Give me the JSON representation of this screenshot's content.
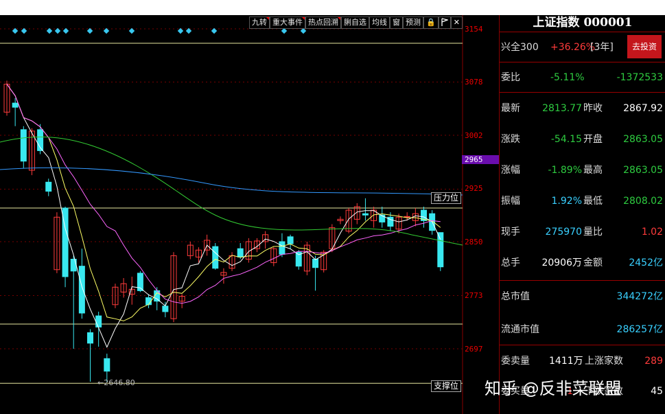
{
  "toolbar": {
    "buttons": [
      "九转",
      "重大事件",
      "热点回溯",
      "脷自选",
      "均线",
      "窗",
      "预测"
    ],
    "lock_icon": "lock-icon",
    "flag_icon": "flag-icon",
    "close_icon": "close-icon"
  },
  "price_axis": {
    "ticks": [
      "3154",
      "3078",
      "3002",
      "2925",
      "2850",
      "2773",
      "2697"
    ],
    "highlight": "2965"
  },
  "chart_labels": {
    "pressure": "压力位",
    "support": "支撑位",
    "low_marker": "2646.80"
  },
  "colors": {
    "up": "#ff3b3b",
    "down": "#39e8f0",
    "ma5": "#ffffff",
    "ma10": "#ffff66",
    "ma20": "#ff66ff",
    "ma60": "#33cc33",
    "ma120": "#3399ff"
  },
  "chart_data": {
    "type": "candlestick",
    "ylim": [
      2640,
      3160
    ],
    "price_ticks": [
      3154,
      3078,
      3002,
      2925,
      2850,
      2773,
      2697
    ],
    "current_price_marker": 2965,
    "pressure_level": 2898,
    "support_level": 2646.8,
    "low_label": 2646.8,
    "candles": [
      {
        "o": 3035,
        "c": 3075,
        "h": 3080,
        "l": 3030
      },
      {
        "o": 3048,
        "c": 3042,
        "h": 3055,
        "l": 3015
      },
      {
        "o": 3010,
        "c": 2965,
        "h": 3015,
        "l": 2955
      },
      {
        "o": 2952,
        "c": 3008,
        "h": 3012,
        "l": 2945
      },
      {
        "o": 3010,
        "c": 2980,
        "h": 3018,
        "l": 2975
      },
      {
        "o": 2935,
        "c": 2922,
        "h": 2940,
        "l": 2915
      },
      {
        "o": 2810,
        "c": 2885,
        "h": 2892,
        "l": 2805
      },
      {
        "o": 2898,
        "c": 2800,
        "h": 2900,
        "l": 2785
      },
      {
        "o": 2825,
        "c": 2808,
        "h": 2830,
        "l": 2697
      },
      {
        "o": 2815,
        "c": 2748,
        "h": 2840,
        "l": 2740
      },
      {
        "o": 2720,
        "c": 2705,
        "h": 2725,
        "l": 2650
      },
      {
        "o": 2744,
        "c": 2728,
        "h": 2750,
        "l": 2700
      },
      {
        "o": 2683,
        "c": 2665,
        "h": 2690,
        "l": 2650
      },
      {
        "o": 2760,
        "c": 2785,
        "h": 2790,
        "l": 2755
      },
      {
        "o": 2778,
        "c": 2790,
        "h": 2798,
        "l": 2770
      },
      {
        "o": 2775,
        "c": 2782,
        "h": 2800,
        "l": 2760
      },
      {
        "o": 2805,
        "c": 2780,
        "h": 2808,
        "l": 2778
      },
      {
        "o": 2770,
        "c": 2760,
        "h": 2775,
        "l": 2755
      },
      {
        "o": 2780,
        "c": 2765,
        "h": 2785,
        "l": 2752
      },
      {
        "o": 2758,
        "c": 2750,
        "h": 2764,
        "l": 2742
      },
      {
        "o": 2740,
        "c": 2830,
        "h": 2835,
        "l": 2735
      },
      {
        "o": 2765,
        "c": 2772,
        "h": 2775,
        "l": 2755
      },
      {
        "o": 2830,
        "c": 2845,
        "h": 2850,
        "l": 2825
      },
      {
        "o": 2828,
        "c": 2838,
        "h": 2842,
        "l": 2820
      },
      {
        "o": 2838,
        "c": 2852,
        "h": 2860,
        "l": 2830
      },
      {
        "o": 2843,
        "c": 2812,
        "h": 2848,
        "l": 2810
      },
      {
        "o": 2802,
        "c": 2806,
        "h": 2812,
        "l": 2790
      },
      {
        "o": 2812,
        "c": 2830,
        "h": 2835,
        "l": 2808
      },
      {
        "o": 2840,
        "c": 2828,
        "h": 2848,
        "l": 2825
      },
      {
        "o": 2825,
        "c": 2850,
        "h": 2855,
        "l": 2820
      },
      {
        "o": 2840,
        "c": 2851,
        "h": 2855,
        "l": 2835
      },
      {
        "o": 2850,
        "c": 2860,
        "h": 2865,
        "l": 2840
      },
      {
        "o": 2820,
        "c": 2840,
        "h": 2842,
        "l": 2815
      },
      {
        "o": 2850,
        "c": 2832,
        "h": 2862,
        "l": 2828
      },
      {
        "o": 2857,
        "c": 2847,
        "h": 2860,
        "l": 2840
      },
      {
        "o": 2835,
        "c": 2815,
        "h": 2838,
        "l": 2810
      },
      {
        "o": 2808,
        "c": 2845,
        "h": 2850,
        "l": 2802
      },
      {
        "o": 2825,
        "c": 2813,
        "h": 2830,
        "l": 2780
      },
      {
        "o": 2810,
        "c": 2835,
        "h": 2838,
        "l": 2806
      },
      {
        "o": 2840,
        "c": 2870,
        "h": 2875,
        "l": 2835
      },
      {
        "o": 2880,
        "c": 2882,
        "h": 2886,
        "l": 2875
      },
      {
        "o": 2865,
        "c": 2895,
        "h": 2898,
        "l": 2862
      },
      {
        "o": 2882,
        "c": 2900,
        "h": 2905,
        "l": 2875
      },
      {
        "o": 2890,
        "c": 2888,
        "h": 2912,
        "l": 2880
      },
      {
        "o": 2880,
        "c": 2895,
        "h": 2900,
        "l": 2870
      },
      {
        "o": 2888,
        "c": 2878,
        "h": 2900,
        "l": 2870
      },
      {
        "o": 2885,
        "c": 2872,
        "h": 2892,
        "l": 2865
      },
      {
        "o": 2868,
        "c": 2885,
        "h": 2890,
        "l": 2862
      },
      {
        "o": 2885,
        "c": 2886,
        "h": 2892,
        "l": 2880
      },
      {
        "o": 2880,
        "c": 2890,
        "h": 2898,
        "l": 2872
      },
      {
        "o": 2895,
        "c": 2880,
        "h": 2900,
        "l": 2870
      },
      {
        "o": 2890,
        "c": 2866,
        "h": 2895,
        "l": 2860
      },
      {
        "o": 2863,
        "c": 2814,
        "h": 2863,
        "l": 2808
      }
    ]
  },
  "panel": {
    "title": "上证指数 000001",
    "row1": {
      "label": "兴全300",
      "pct": "+36.26%",
      "period": "[3年]",
      "button": "去投资"
    },
    "row2": {
      "label": "委比",
      "v1": "-5.11%",
      "v2": "-1372533"
    },
    "rows": [
      {
        "l1": "最新",
        "v1": "2813.77",
        "l2": "昨收",
        "v2": "2867.92",
        "c1": "g",
        "c2": "w"
      },
      {
        "l1": "涨跌",
        "v1": "-54.15",
        "l2": "开盘",
        "v2": "2863.05",
        "c1": "g",
        "c2": "g"
      },
      {
        "l1": "涨幅",
        "v1": "-1.89%",
        "l2": "最高",
        "v2": "2863.05",
        "c1": "g",
        "c2": "g"
      },
      {
        "l1": "振幅",
        "v1": "1.92%",
        "l2": "最低",
        "v2": "2808.02",
        "c1": "c",
        "c2": "g"
      },
      {
        "l1": "现手",
        "v1": "275970",
        "l2": "量比",
        "v2": "1.02",
        "c1": "c",
        "c2": "r"
      },
      {
        "l1": "总手",
        "v1": "20906万",
        "l2": "金额",
        "v2": "2452亿",
        "c1": "w",
        "c2": "c"
      }
    ],
    "market_cap": {
      "label": "总市值",
      "value": "344272亿"
    },
    "float_cap": {
      "label": "流通市值",
      "value": "286257亿"
    },
    "bid": {
      "label": "委卖量",
      "value": "1411万",
      "label2": "上涨家数",
      "value2": "289"
    },
    "ask": {
      "label": "委买量",
      "value": "1",
      "label2": "下跌家数",
      "value2": "45"
    }
  },
  "watermark": "知乎 @反非菜联盟"
}
